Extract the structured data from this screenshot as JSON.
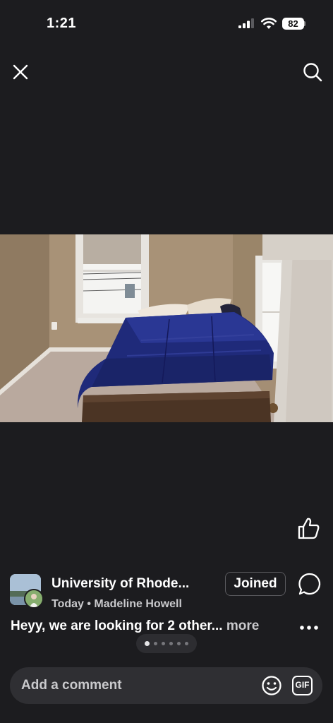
{
  "status_bar": {
    "time": "1:21",
    "battery": "82"
  },
  "header": {
    "close_icon": "close-icon",
    "search_icon": "search-icon"
  },
  "post": {
    "image_desc_icon": "photo",
    "group_name": "University of Rhode...",
    "meta": "Today • Madeline Howell",
    "joined_label": "Joined",
    "caption": "Heyy, we are looking for 2 other...",
    "more_label": "more",
    "page_count": 6,
    "active_page": 0
  },
  "comment_bar": {
    "placeholder": "Add a comment",
    "gif_label": "GIF"
  },
  "colors": {
    "background": "#1c1c1f",
    "comforter": "#1f2a7a",
    "wall": "#a48e74"
  }
}
